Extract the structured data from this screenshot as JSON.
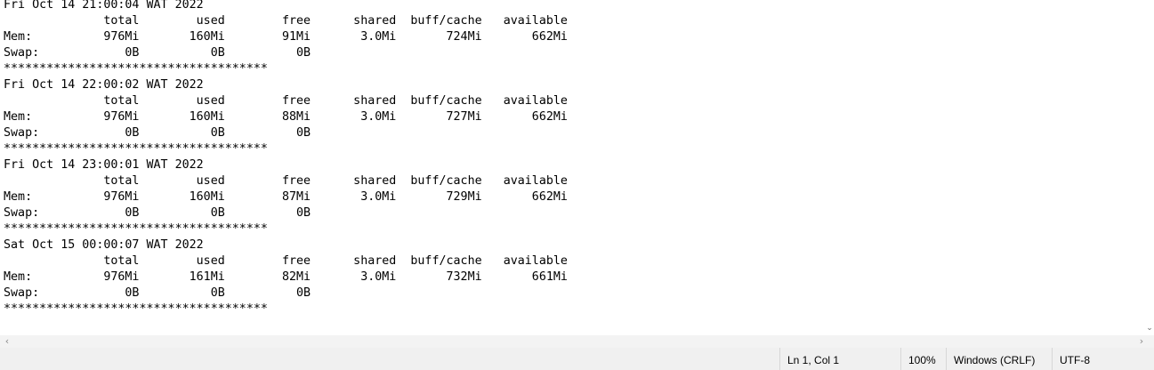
{
  "editor": {
    "text": "Fri Oct 14 21:00:04 WAT 2022\n              total        used        free      shared  buff/cache   available\nMem:          976Mi       160Mi        91Mi       3.0Mi       724Mi       662Mi\nSwap:            0B          0B          0B\n*************************************\nFri Oct 14 22:00:02 WAT 2022\n              total        used        free      shared  buff/cache   available\nMem:          976Mi       160Mi        88Mi       3.0Mi       727Mi       662Mi\nSwap:            0B          0B          0B\n*************************************\nFri Oct 14 23:00:01 WAT 2022\n              total        used        free      shared  buff/cache   available\nMem:          976Mi       160Mi        87Mi       3.0Mi       729Mi       662Mi\nSwap:            0B          0B          0B\n*************************************\nSat Oct 15 00:00:07 WAT 2022\n              total        used        free      shared  buff/cache   available\nMem:          976Mi       161Mi        82Mi       3.0Mi       732Mi       661Mi\nSwap:            0B          0B          0B\n*************************************"
  },
  "scrollbars": {
    "left_arrow": "‹",
    "right_arrow": "›",
    "down_arrow": "⌄"
  },
  "status_bar": {
    "position": "Ln 1, Col 1",
    "zoom": "100%",
    "line_ending": "Windows (CRLF)",
    "encoding": "UTF-8"
  }
}
